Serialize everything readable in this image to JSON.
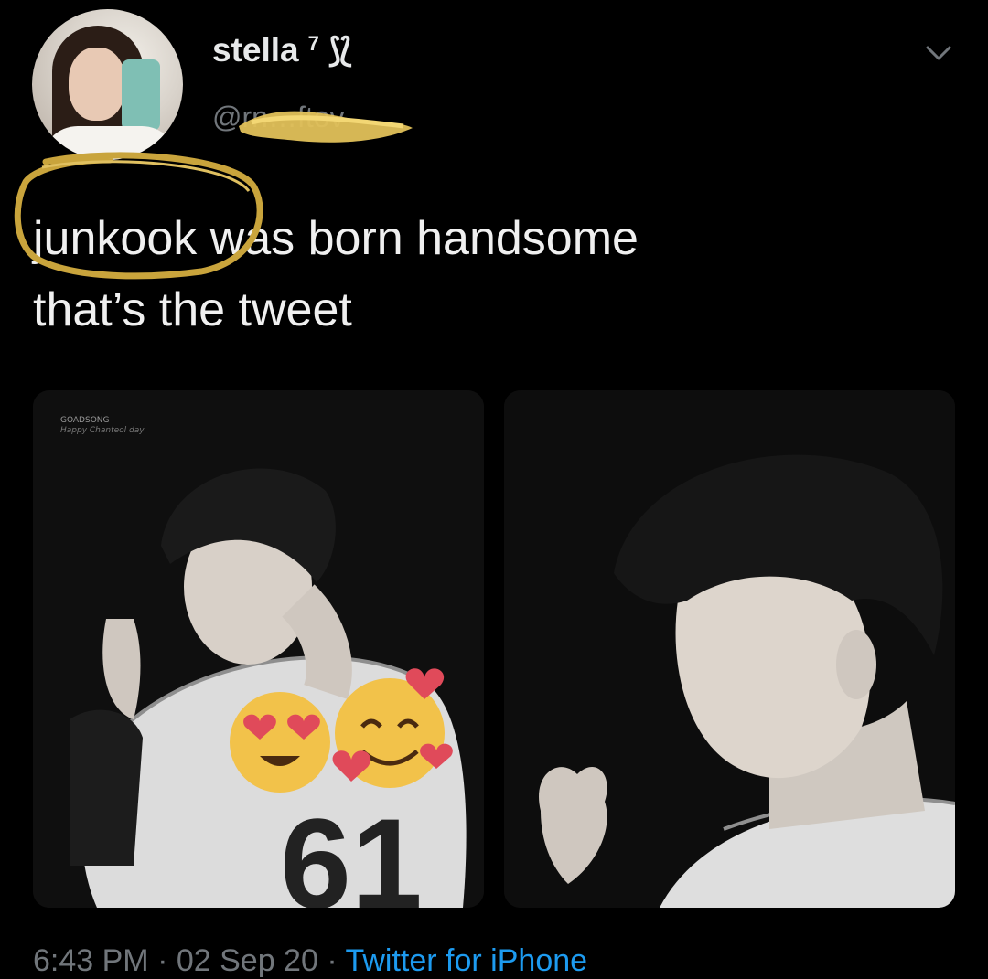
{
  "tweet": {
    "author": {
      "display_name": "stella",
      "badge": "7",
      "logo_glyph": "⟆⟅",
      "handle": "@rn…ftov"
    },
    "menu_icon": "chevron-down-icon",
    "text_lines": [
      "junkook was born handsome",
      "that’s the tweet"
    ],
    "media": [
      {
        "watermark": "GOADSONG",
        "watermark_sub": "Happy Chanteol day"
      },
      {}
    ],
    "meta": {
      "time": "6:43 PM",
      "separator": " · ",
      "date": "02 Sep 20",
      "source": "Twitter for iPhone"
    },
    "colors": {
      "background": "#000000",
      "text": "#e7e9ea",
      "secondary": "#71767b",
      "link": "#1d9bf0",
      "annotation": "#c9a43c"
    }
  }
}
